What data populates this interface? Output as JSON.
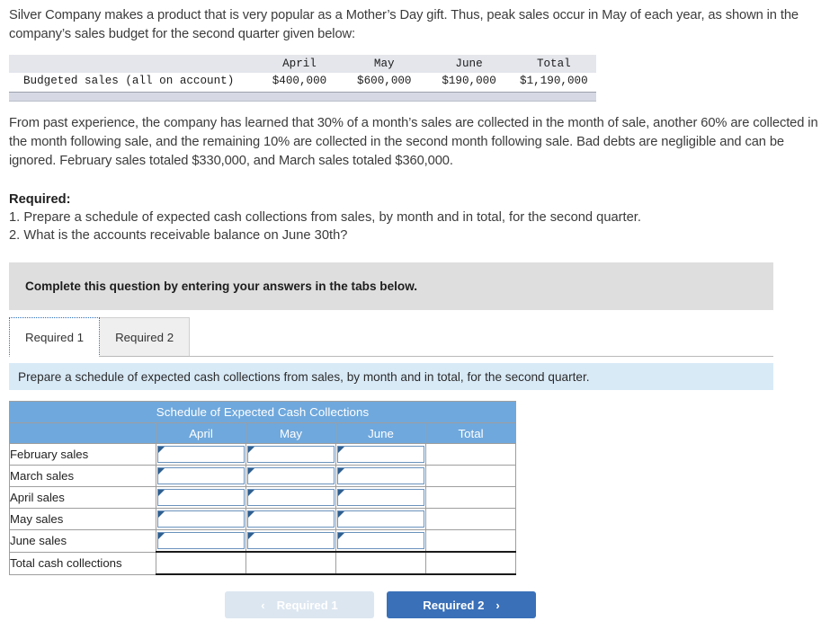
{
  "problem": {
    "paragraph1": "Silver Company makes a product that is very popular as a Mother’s Day gift. Thus, peak sales occur in May of each year, as shown in the company’s sales budget for the second quarter given below:",
    "paragraph2": "From past experience, the company has learned that 30% of a month’s sales are collected in the month of sale, another 60% are collected in the month following sale, and the remaining 10% are collected in the second month following sale. Bad debts are negligible and can be ignored. February sales totaled $330,000, and March sales totaled $360,000.",
    "required_title": "Required:",
    "required_1": "1. Prepare a schedule of expected cash collections from sales, by month and in total, for the second quarter.",
    "required_2": "2. What is the accounts receivable balance on June 30th?"
  },
  "budget_table": {
    "headers": [
      "",
      "April",
      "May",
      "June",
      "Total"
    ],
    "rows": [
      {
        "label": "Budgeted sales (all on account)",
        "values": [
          "$400,000",
          "$600,000",
          "$190,000",
          "$1,190,000"
        ]
      }
    ]
  },
  "banner": {
    "text": "Complete this question by entering your answers in the tabs below."
  },
  "tabs": [
    {
      "label": "Required 1",
      "active": true
    },
    {
      "label": "Required 2",
      "active": false
    }
  ],
  "instruction_strip": {
    "text": "Prepare a schedule of expected cash collections from sales, by month and in total, for the second quarter."
  },
  "schedule_table": {
    "title": "Schedule of Expected Cash Collections",
    "headers": [
      "",
      "April",
      "May",
      "June",
      "Total"
    ],
    "rows": [
      {
        "label": "February sales",
        "cells": [
          "input",
          "input",
          "input",
          "blank"
        ]
      },
      {
        "label": "March sales",
        "cells": [
          "input",
          "input",
          "input",
          "blank"
        ]
      },
      {
        "label": "April sales",
        "cells": [
          "input",
          "input",
          "input",
          "blank"
        ]
      },
      {
        "label": "May sales",
        "cells": [
          "input",
          "input",
          "input",
          "blank"
        ]
      },
      {
        "label": "June sales",
        "cells": [
          "input",
          "input",
          "input",
          "blank"
        ]
      },
      {
        "label": "Total cash collections",
        "cells": [
          "blank",
          "blank",
          "blank",
          "blank"
        ]
      }
    ]
  },
  "nav": {
    "prev_label": "Required 1",
    "prev_chevron": "‹",
    "next_label": "Required 2",
    "next_chevron": "›"
  },
  "colors": {
    "header_blue": "#6fa8dc",
    "strip_blue": "#d9eaf7",
    "banner_gray": "#dedede",
    "button_blue": "#3a70b8",
    "button_disabled": "#dce6f0",
    "input_border": "#6a92bd"
  }
}
